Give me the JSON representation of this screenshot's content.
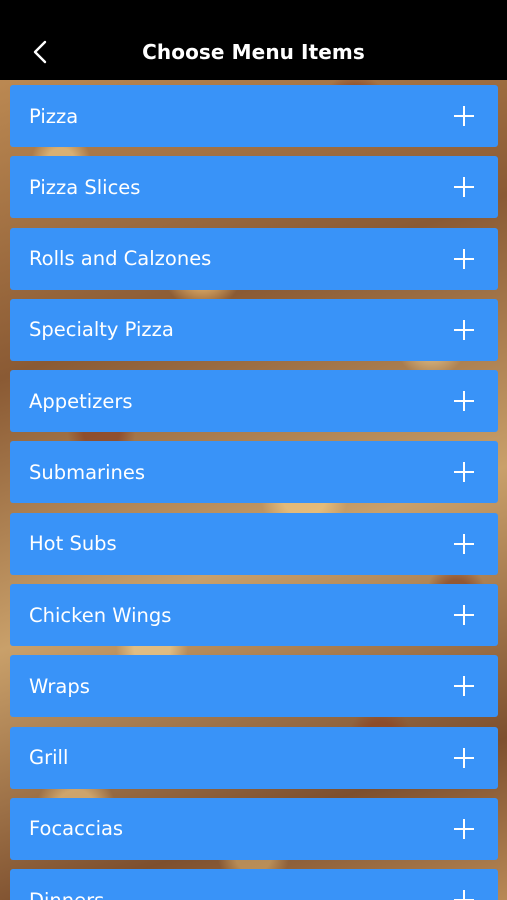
{
  "header": {
    "title": "Choose Menu Items",
    "back_icon": "chevron-left-icon"
  },
  "menu": {
    "items": [
      {
        "label": "Pizza"
      },
      {
        "label": "Pizza Slices"
      },
      {
        "label": "Rolls and Calzones"
      },
      {
        "label": "Specialty Pizza"
      },
      {
        "label": "Appetizers"
      },
      {
        "label": "Submarines"
      },
      {
        "label": "Hot Subs"
      },
      {
        "label": "Chicken Wings"
      },
      {
        "label": "Wraps"
      },
      {
        "label": "Grill"
      },
      {
        "label": "Focaccias"
      },
      {
        "label": "Dinners"
      }
    ],
    "expand_icon": "plus-icon"
  },
  "colors": {
    "header_background": "#000000",
    "item_background": "#3993f8",
    "text": "#ffffff"
  }
}
